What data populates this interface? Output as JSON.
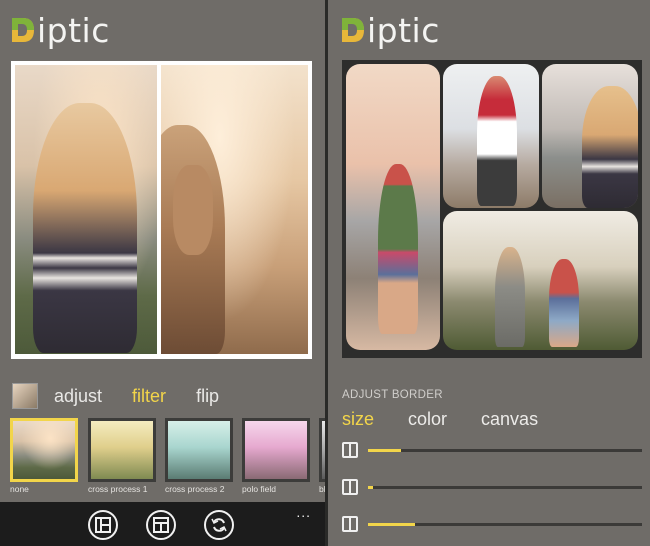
{
  "app": {
    "name": "iptic",
    "accent": "#f2d54a",
    "logo_colors": [
      "#7fb33a",
      "#e8b73a"
    ]
  },
  "left": {
    "tabs": [
      {
        "label": "adjust",
        "active": false
      },
      {
        "label": "filter",
        "active": true
      },
      {
        "label": "flip",
        "active": false
      }
    ],
    "filters": [
      {
        "label": "none",
        "selected": true
      },
      {
        "label": "cross process 1",
        "selected": false
      },
      {
        "label": "cross process 2",
        "selected": false
      },
      {
        "label": "polo field",
        "selected": false
      },
      {
        "label": "bl",
        "selected": false
      }
    ],
    "appbar": {
      "buttons": [
        "layout-icon",
        "grid-layout-icon",
        "refresh-icon"
      ],
      "more": "..."
    }
  },
  "right": {
    "section_title": "ADJUST BORDER",
    "subtabs": [
      {
        "label": "size",
        "active": true
      },
      {
        "label": "color",
        "active": false
      },
      {
        "label": "canvas",
        "active": false
      }
    ],
    "sliders": [
      {
        "name": "border-size-slider",
        "value": 0.12
      },
      {
        "name": "border-color-slider",
        "value": 0.02
      },
      {
        "name": "border-canvas-slider",
        "value": 0.17
      }
    ]
  }
}
